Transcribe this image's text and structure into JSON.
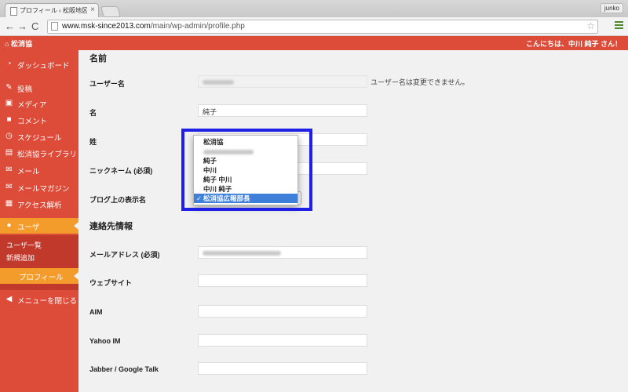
{
  "browser": {
    "tab_title": "プロフィール ‹ 松阪地区広報",
    "tab_close": "×",
    "user_badge": "junko",
    "url_host": "www.msk-since2013.com",
    "url_path": "/main/wp-admin/profile.php",
    "back": "←",
    "forward": "→",
    "reload": "C",
    "star": "☆"
  },
  "adminbar": {
    "site_name": "松消協",
    "greeting": "こんにちは、中川 純子 さん！"
  },
  "sidebar": {
    "items": [
      {
        "label": "ダッシュボード",
        "icon": "dashboard-icon"
      },
      {
        "label": "投稿",
        "icon": "pin-icon"
      },
      {
        "label": "メディア",
        "icon": "media-icon"
      },
      {
        "label": "コメント",
        "icon": "comment-icon"
      },
      {
        "label": "スケジュール",
        "icon": "schedule-icon"
      },
      {
        "label": "松消協ライブラリ",
        "icon": "library-icon"
      },
      {
        "label": "メール",
        "icon": "mail-icon"
      },
      {
        "label": "メールマガジン",
        "icon": "newsletter-icon"
      },
      {
        "label": "アクセス解析",
        "icon": "stats-icon"
      },
      {
        "label": "ユーザ",
        "icon": "user-icon"
      }
    ],
    "submenu": [
      "ユーザ一覧",
      "新規追加",
      "プロフィール"
    ],
    "collapse": "メニューを閉じる"
  },
  "form": {
    "section_name": "名前",
    "username_label": "ユーザー名",
    "username_note": "ユーザー名は変更できません。",
    "first_name_label": "名",
    "first_name_value": "純子",
    "last_name_label": "姓",
    "nickname_label": "ニックネーム (必須)",
    "display_name_label": "ブログ上の表示名",
    "section_contact": "連絡先情報",
    "email_label": "メールアドレス (必須)",
    "website_label": "ウェブサイト",
    "aim_label": "AIM",
    "yahoo_label": "Yahoo IM",
    "jabber_label": "Jabber / Google Talk"
  },
  "display_name_options": {
    "options": [
      "松消協",
      "",
      "純子",
      "中川",
      "純子 中川",
      "中川 純子",
      "松消協広報部長"
    ],
    "selected": "松消協広報部長",
    "check": "✓"
  },
  "colors": {
    "admin_red": "#dd4b39",
    "active_orange": "#f39c2c",
    "highlight_blue": "#1f1fe6",
    "selected_option": "#3d7fd9"
  }
}
